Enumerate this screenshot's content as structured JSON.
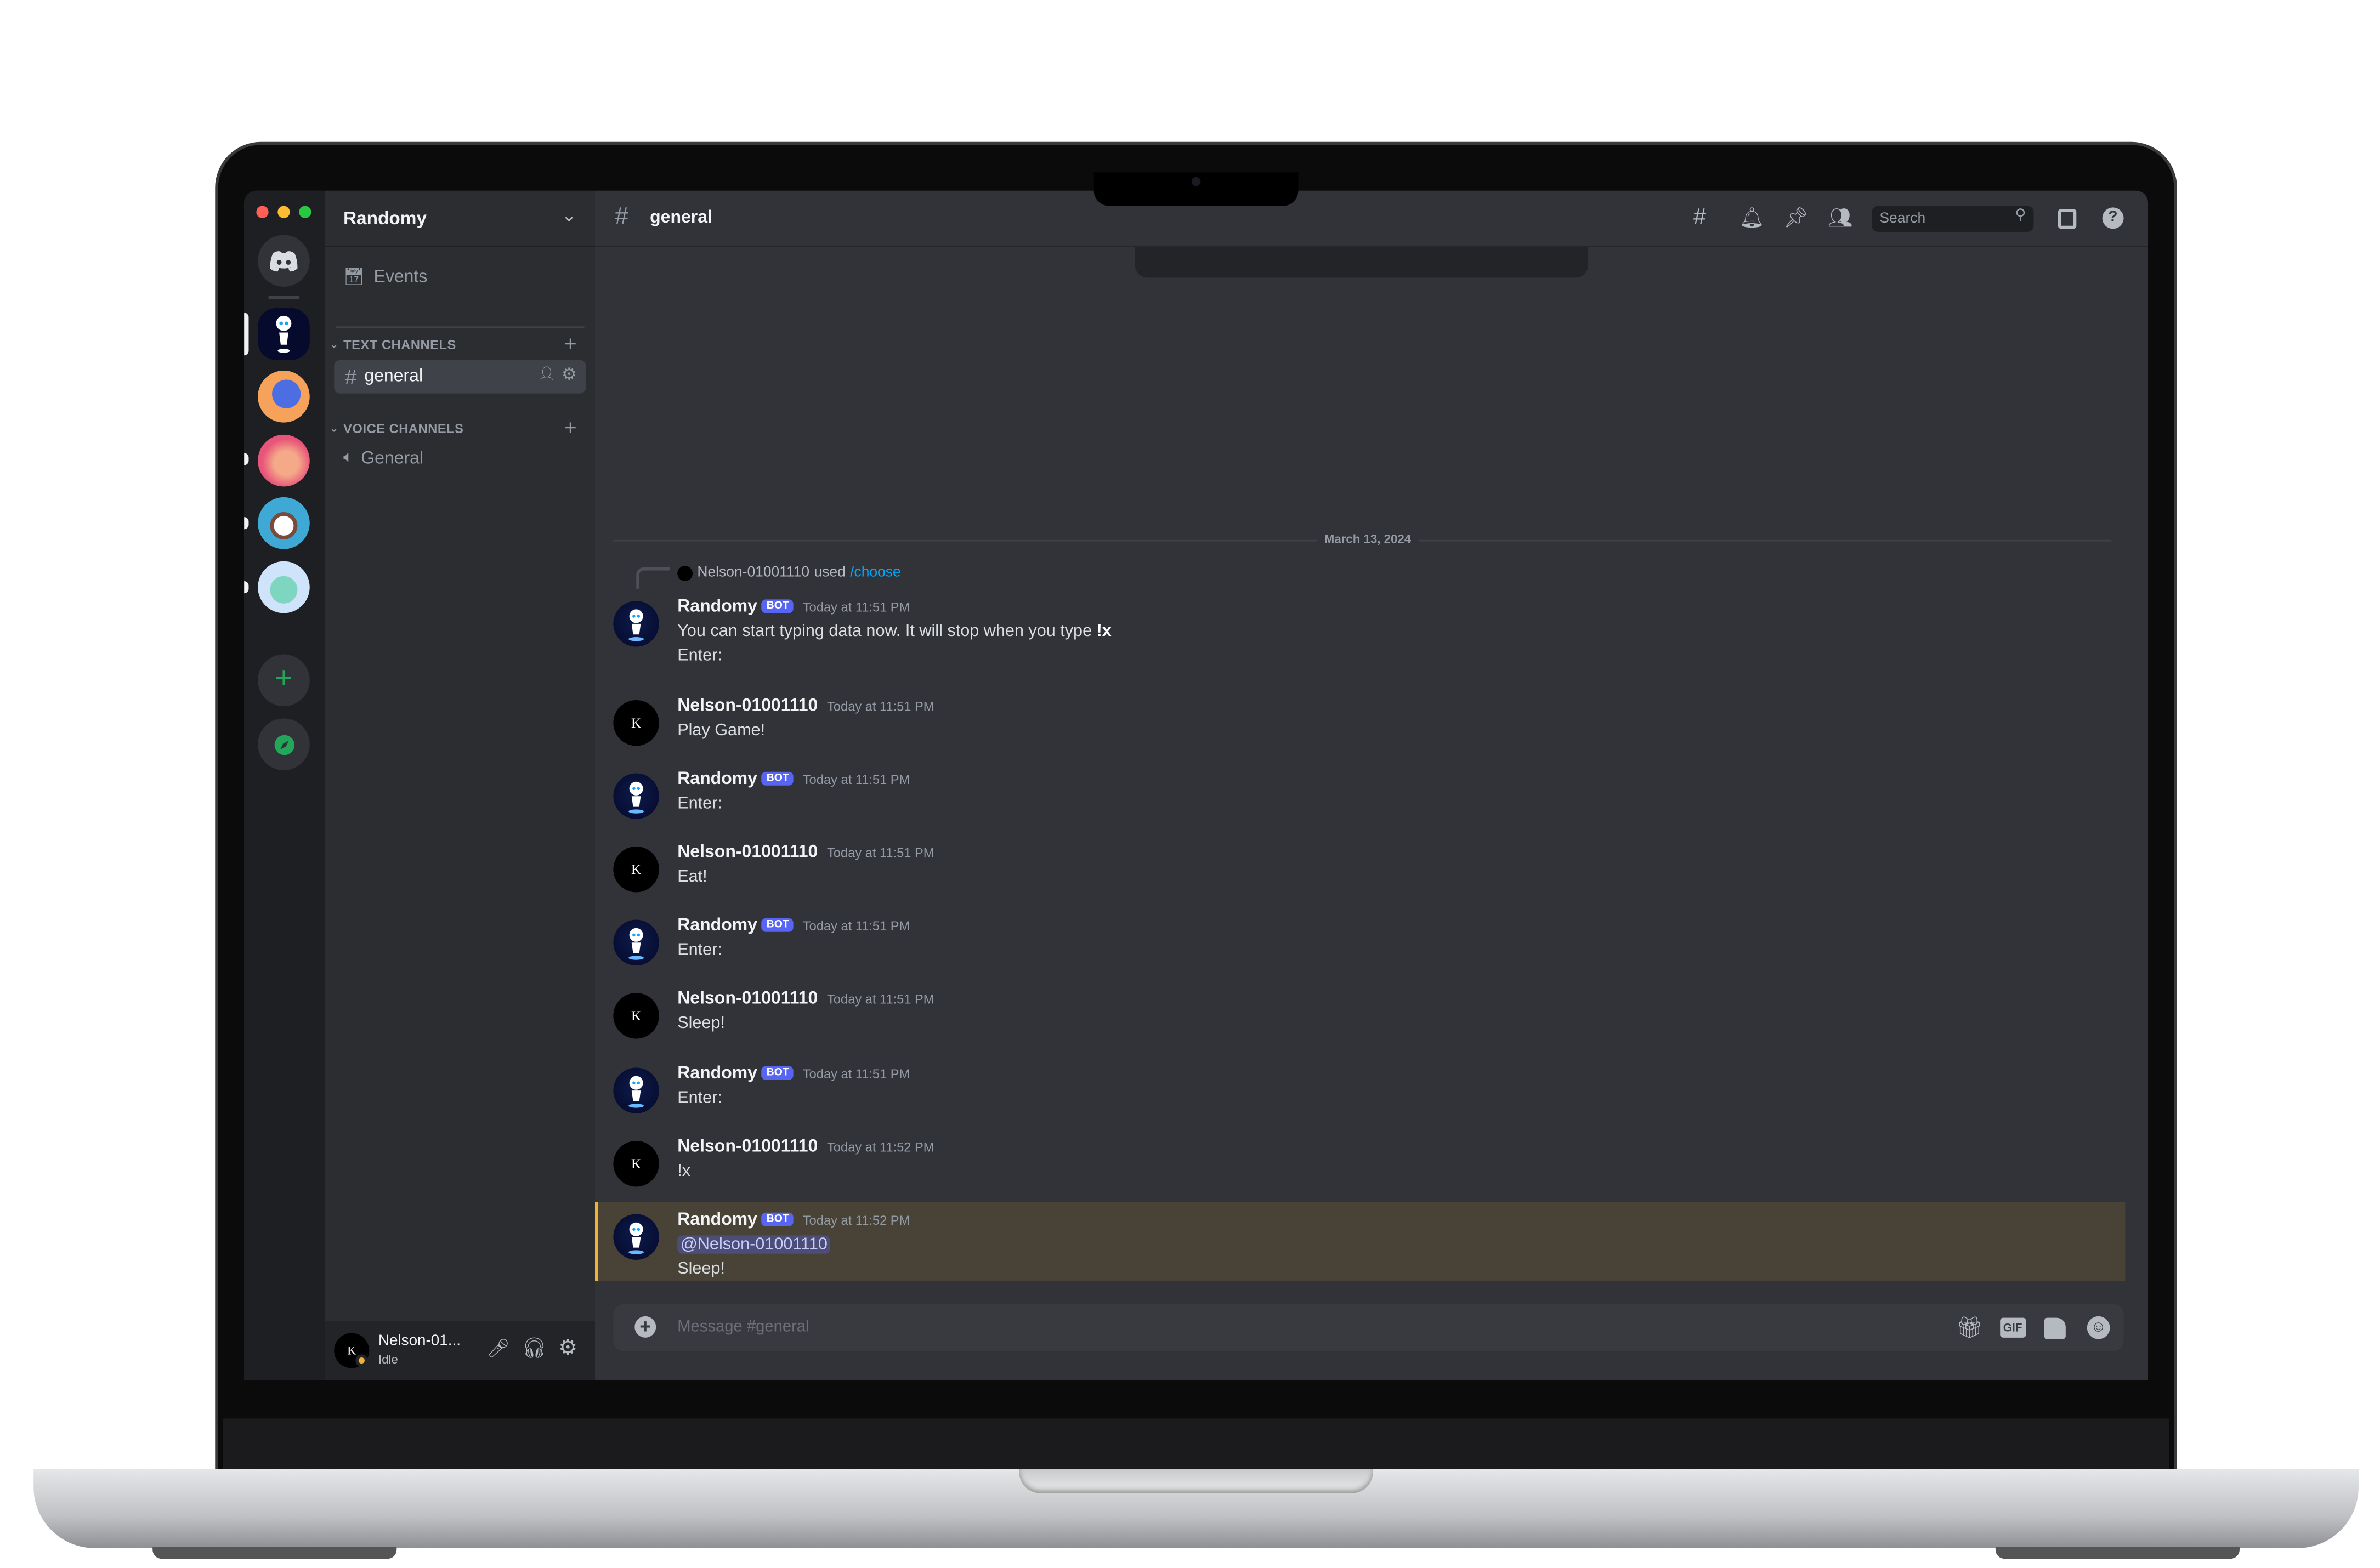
{
  "server": {
    "name": "Randomy"
  },
  "sidebar": {
    "events_label": "Events",
    "text_category": "TEXT CHANNELS",
    "voice_category": "VOICE CHANNELS",
    "text_channels": [
      {
        "name": "general",
        "selected": true
      }
    ],
    "voice_channels": [
      {
        "name": "General"
      }
    ]
  },
  "header": {
    "channel": "general",
    "search_placeholder": "Search"
  },
  "chat": {
    "date_divider": "March 13, 2024",
    "command": {
      "user": "Nelson-01001110",
      "used": "used",
      "command": "/choose"
    },
    "messages": [
      {
        "author": "Randomy",
        "bot": true,
        "time": "Today at 11:51 PM",
        "lines": [
          {
            "text": "You can start typing data now. It will stop when you type ",
            "bold": "!x"
          },
          {
            "text": "Enter:"
          }
        ]
      },
      {
        "author": "Nelson-01001110",
        "bot": false,
        "time": "Today at 11:51 PM",
        "lines": [
          {
            "text": "Play Game!"
          }
        ]
      },
      {
        "author": "Randomy",
        "bot": true,
        "time": "Today at 11:51 PM",
        "lines": [
          {
            "text": "Enter:"
          }
        ]
      },
      {
        "author": "Nelson-01001110",
        "bot": false,
        "time": "Today at 11:51 PM",
        "lines": [
          {
            "text": "Eat!"
          }
        ]
      },
      {
        "author": "Randomy",
        "bot": true,
        "time": "Today at 11:51 PM",
        "lines": [
          {
            "text": "Enter:"
          }
        ]
      },
      {
        "author": "Nelson-01001110",
        "bot": false,
        "time": "Today at 11:51 PM",
        "lines": [
          {
            "text": "Sleep!"
          }
        ]
      },
      {
        "author": "Randomy",
        "bot": true,
        "time": "Today at 11:51 PM",
        "lines": [
          {
            "text": "Enter:"
          }
        ]
      },
      {
        "author": "Nelson-01001110",
        "bot": false,
        "time": "Today at 11:52 PM",
        "lines": [
          {
            "text": "!x"
          }
        ]
      },
      {
        "author": "Randomy",
        "bot": true,
        "time": "Today at 11:52 PM",
        "highlighted": true,
        "lines": [
          {
            "mention": "@Nelson-01001110"
          },
          {
            "text": "Sleep!"
          }
        ]
      }
    ],
    "bot_badge": "BOT",
    "avatar_letter": "K"
  },
  "composer": {
    "placeholder": "Message #general"
  },
  "user_panel": {
    "name": "Nelson-01...",
    "status": "Idle"
  },
  "colors": {
    "accent": "#5865f2",
    "link": "#00a8fc",
    "mention_highlight": "#f0b232",
    "add_server": "#23a55a"
  }
}
